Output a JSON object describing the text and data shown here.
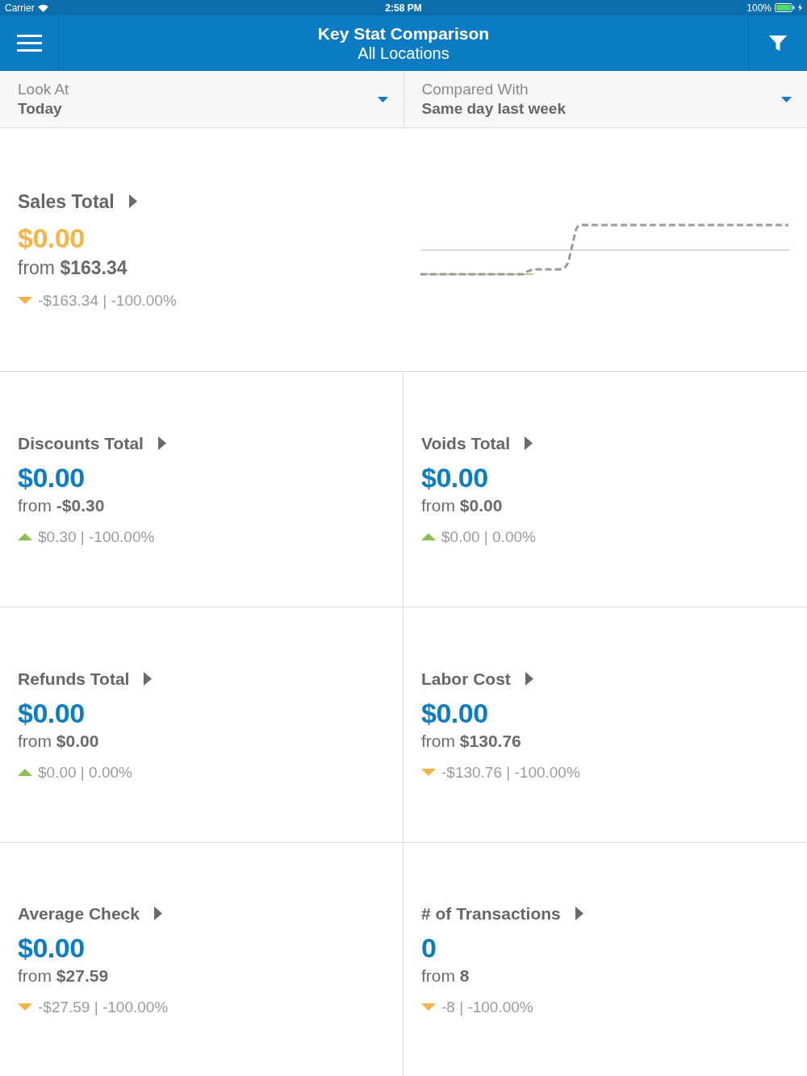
{
  "status_bar": {
    "carrier": "Carrier",
    "time": "2:58 PM",
    "battery": "100%"
  },
  "header": {
    "title": "Key Stat Comparison",
    "subtitle": "All Locations"
  },
  "selectors": [
    {
      "label": "Look At",
      "value": "Today"
    },
    {
      "label": "Compared With",
      "value": "Same day last week"
    }
  ],
  "stats": [
    {
      "kind": "featured",
      "title": "Sales Total",
      "value": "$0.00",
      "comparison": "from **$163.34**",
      "trend_up": false,
      "change": "-$163.34 | -100.00%"
    },
    {
      "kind": "stat",
      "title": "Discounts Total",
      "value": "$0.00",
      "comparison": "from **-$0.30**",
      "trend_up": true,
      "change": "$0.30 | -100.00%"
    },
    {
      "kind": "stat",
      "title": "Voids Total",
      "value": "$0.00",
      "comparison": "from **$0.00**",
      "trend_up": true,
      "change": "$0.00 | 0.00%"
    },
    {
      "kind": "stat",
      "title": "Refunds Total",
      "value": "$0.00",
      "comparison": "from **$0.00**",
      "trend_up": true,
      "change": "$0.00 | 0.00%"
    },
    {
      "kind": "stat",
      "title": "Labor Cost",
      "value": "$0.00",
      "comparison": "from **$130.76**",
      "trend_up": false,
      "change": "-$130.76 | -100.00%"
    },
    {
      "kind": "stat",
      "title": "Average Check",
      "value": "$0.00",
      "comparison": "from **$27.59**",
      "trend_up": false,
      "change": "-$27.59 | -100.00%"
    },
    {
      "kind": "stat",
      "title": "# of Transactions",
      "value": "0",
      "comparison": "from **8**",
      "trend_up": false,
      "change": "-8 | -100.00%"
    }
  ]
}
